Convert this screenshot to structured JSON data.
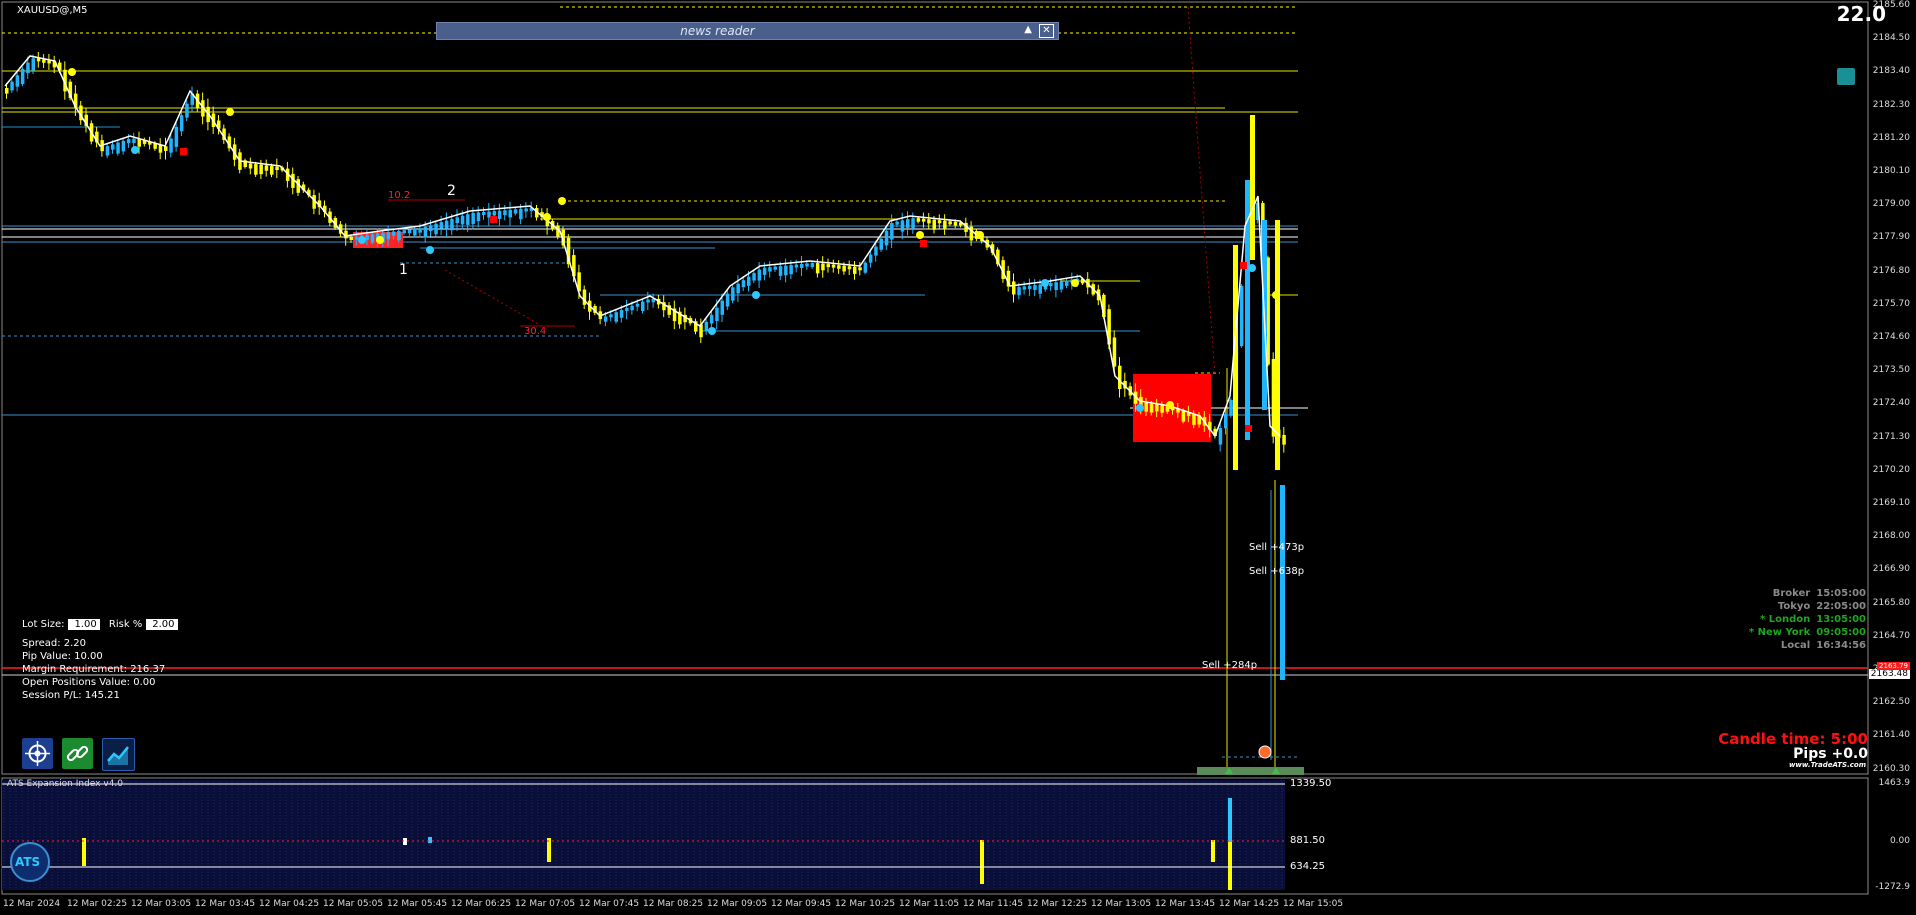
{
  "symbol": "XAUUSD@,M5",
  "spread_display": "22.0",
  "news_reader": {
    "label": "news reader",
    "collapse_icon": "triangle-up-icon",
    "close_icon": "close-icon"
  },
  "price_axis": [
    "2185.60",
    "2184.50",
    "2183.40",
    "2182.30",
    "2181.20",
    "2180.10",
    "2179.00",
    "2177.90",
    "2176.80",
    "2175.70",
    "2174.60",
    "2173.50",
    "2172.40",
    "2171.30",
    "2170.20",
    "2169.10",
    "2168.00",
    "2166.90",
    "2165.80",
    "2164.70",
    "2163.48",
    "2162.50",
    "2161.40",
    "2160.30"
  ],
  "current_price": "2163.48",
  "bid_tag": "2163.79",
  "time_axis": [
    "12 Mar 2024",
    "12 Mar 02:25",
    "12 Mar 03:05",
    "12 Mar 03:45",
    "12 Mar 04:25",
    "12 Mar 05:05",
    "12 Mar 05:45",
    "12 Mar 06:25",
    "12 Mar 07:05",
    "12 Mar 07:45",
    "12 Mar 08:25",
    "12 Mar 09:05",
    "12 Mar 09:45",
    "12 Mar 10:25",
    "12 Mar 11:05",
    "12 Mar 11:45",
    "12 Mar 12:25",
    "12 Mar 13:05",
    "12 Mar 13:45",
    "12 Mar 14:25",
    "12 Mar 15:05"
  ],
  "annotations": {
    "label_10_2": "10.2",
    "label_2": "2",
    "label_1": "1",
    "label_30_4": "30.4"
  },
  "trades": [
    {
      "label": "Sell +473p"
    },
    {
      "label": "Sell +638p"
    },
    {
      "label": "Sell +284p"
    }
  ],
  "order_panel": {
    "lot_size_label": "Lot Size:",
    "lot_size_value": "1.00",
    "risk_label": "Risk %",
    "risk_value": "2.00",
    "spread": "Spread: 2.20",
    "pip_value": "Pip Value: 10.00",
    "margin": "Margin Requirement: 216.37",
    "open_positions": "Open Positions Value: 0.00",
    "session_pl": "Session P/L: 145.21"
  },
  "tools": [
    {
      "name": "crosshair-target-icon",
      "color": "#1d3f8f"
    },
    {
      "name": "link-chain-icon",
      "color": "#1c8a2e"
    },
    {
      "name": "chart-trend-icon",
      "color": "#0b1e46"
    }
  ],
  "clocks": [
    {
      "name": "Broker",
      "time": "15:05:00",
      "color": "#8a8a8a"
    },
    {
      "name": "Tokyo",
      "time": "22:05:00",
      "color": "#8a8a8a"
    },
    {
      "name": "* London",
      "time": "13:05:00",
      "color": "#1fa51f"
    },
    {
      "name": "* New York",
      "time": "09:05:00",
      "color": "#1fa51f"
    },
    {
      "name": "Local",
      "time": "16:34:56",
      "color": "#8a8a8a"
    }
  ],
  "candle_time": "Candle time:  5:00",
  "pips": "Pips +0.0",
  "brand": "www.TradeATS.com",
  "indicator": {
    "title": "ATS Expansion Index v4.0",
    "levels": [
      "1339.50",
      "881.50",
      "634.25"
    ],
    "axis": [
      "1463.9",
      "0.00",
      "-1272.9"
    ],
    "logo": "ATS"
  },
  "colors": {
    "bull": "#1fb6ff",
    "bear": "#ffff00",
    "ma": "#ffffff",
    "red": "#ff0000"
  }
}
